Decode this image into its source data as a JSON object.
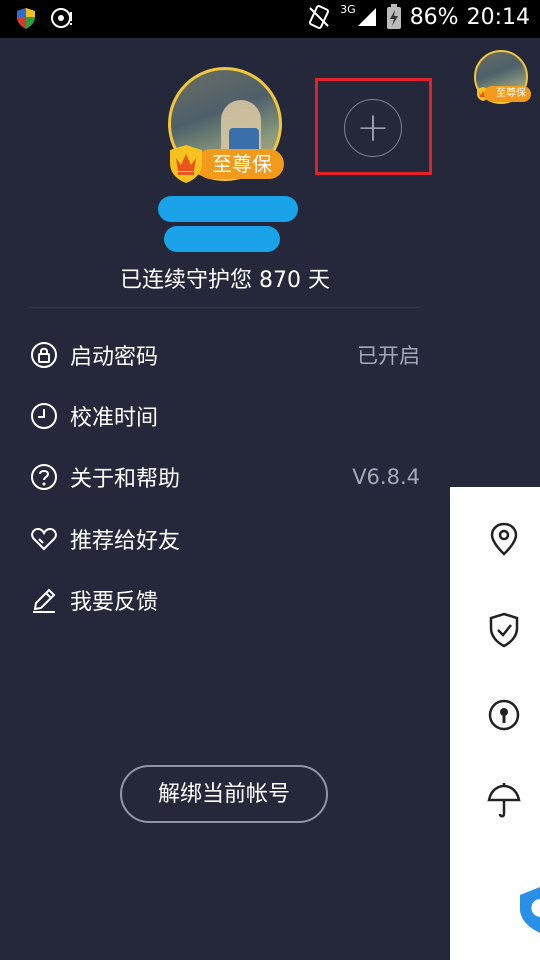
{
  "status_bar": {
    "network": "3G",
    "battery": "86%",
    "time": "20:14"
  },
  "profile": {
    "badge_label": "至尊保",
    "protect_text": "已连续守护您 870 天",
    "mini_badge_label": "至尊保"
  },
  "menu": [
    {
      "label": "启动密码",
      "value": "已开启",
      "icon": "lock-icon"
    },
    {
      "label": "校准时间",
      "value": "",
      "icon": "clock-icon"
    },
    {
      "label": "关于和帮助",
      "value": "V6.8.4",
      "icon": "help-icon"
    },
    {
      "label": "推荐给好友",
      "value": "",
      "icon": "heart-icon"
    },
    {
      "label": "我要反馈",
      "value": "",
      "icon": "pencil-icon"
    }
  ],
  "unbind_button": "解绑当前帐号",
  "side_icons": [
    "location-pin-icon",
    "shield-check-icon",
    "keyhole-icon",
    "umbrella-icon"
  ],
  "colors": {
    "background": "#24283a",
    "badge": "#f29a1c",
    "highlight": "#e0222a",
    "redacted": "#1aa3e8"
  }
}
